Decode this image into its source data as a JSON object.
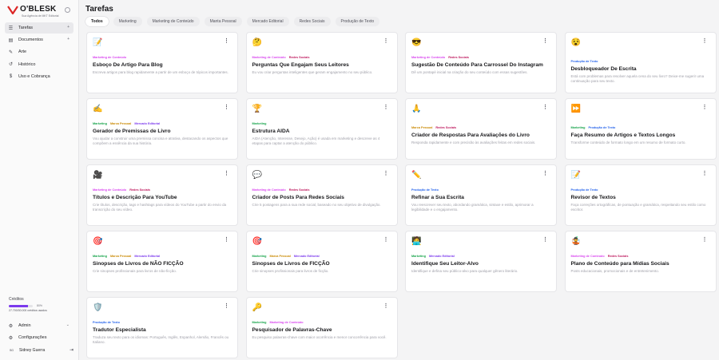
{
  "brand": {
    "name": "O'BLESK",
    "subtitle": "Sua Agência de MKT Editorial",
    "colors": {
      "accent": "#7c3aed",
      "mark": "#dc2626"
    }
  },
  "sidebar": {
    "items": [
      {
        "label": "Tarefas",
        "icon": "list-icon",
        "chevron": "+"
      },
      {
        "label": "Documentos",
        "icon": "document-icon",
        "chevron": "+"
      },
      {
        "label": "Arte",
        "icon": "brush-icon"
      },
      {
        "label": "Histórico",
        "icon": "history-icon"
      },
      {
        "label": "Uso e Cobrança",
        "icon": "billing-icon"
      }
    ],
    "credits": {
      "label": "Créditos",
      "percent_used": 80,
      "percent_text": "80%",
      "detail": "27.700/30.000 créditos usados"
    },
    "bottom": [
      {
        "label": "Admin",
        "icon": "admin-icon",
        "chevron": "⌄"
      },
      {
        "label": "Configurações",
        "icon": "gear-icon"
      }
    ],
    "user": {
      "initials": "SG",
      "name": "Sidney Guerra"
    }
  },
  "page": {
    "title": "Tarefas"
  },
  "tabs": [
    "Todos",
    "Marketing",
    "Marketing de Conteúdo",
    "Manta Pessoal",
    "Mercado Editorial",
    "Redes Sociais",
    "Produção de Texto"
  ],
  "tag_colors": {
    "Marketing de Conteúdo": "#d946ef",
    "Redes Sociais": "#be185d",
    "Produção de Texto": "#2563eb",
    "Marketing": "#16a34a",
    "Marca Pessoal": "#ca8a04",
    "Mercado Editorial": "#7c3aed"
  },
  "cards": [
    {
      "emoji": "📝",
      "tags": [
        "Marketing de Conteúdo"
      ],
      "title": "Esboço De Artigo Para Blog",
      "desc": "Escreva artigos para blog rapidamente a partir de um esboço de tópicos importantes."
    },
    {
      "emoji": "🤔",
      "tags": [
        "Marketing de Conteúdo",
        "Redes Sociais"
      ],
      "title": "Perguntas Que Engajam Seus Leitores",
      "desc": "Eu vou criar perguntas inteligentes que geram engajamento no seu público."
    },
    {
      "emoji": "😎",
      "tags": [
        "Marketing de Conteúdo",
        "Redes Sociais"
      ],
      "title": "Sugestão De Conteúdo Para Carrossel Do Instagram",
      "desc": "Dê um pontapé inicial na criação do seu conteúdo com essas sugestões."
    },
    {
      "emoji": "😵",
      "tags": [
        "Produção de Texto"
      ],
      "title": "Desbloqueador De Escrita",
      "desc": "Está com problemas para resolver aquela cena do seu livro? Deixe-me sugerir uma continuação para seu texto."
    },
    {
      "emoji": "✍️",
      "tags": [
        "Marketing",
        "Marca Pessoal",
        "Mercado Editorial"
      ],
      "title": "Gerador de Premissas de Livro",
      "desc": "Vou ajudar a construir uma premissa concisa e atrativa, destacando os aspectos que compõem a essência da sua história."
    },
    {
      "emoji": "🏆",
      "tags": [
        "Marketing"
      ],
      "title": "Estrutura AIDA",
      "desc": "AIDA (Atenção, Interesse, Desejo, Ação) é usada em marketing e descreve as 4 etapas para captar a atenção do público."
    },
    {
      "emoji": "🙏",
      "tags": [
        "Marca Pessoal",
        "Redes Sociais"
      ],
      "title": "Criador de Respostas Para Avaliações do Livro",
      "desc": "Responda rapidamente e com precisão às avaliações feitas em redes sociais."
    },
    {
      "emoji": "⏩",
      "tags": [
        "Marketing",
        "Produção de Texto"
      ],
      "title": "Faça Resumo de Artigos e Textos Longos",
      "desc": "Transforme conteúdo de formato longo em um resumo de formato curto."
    },
    {
      "emoji": "🎥",
      "tags": [
        "Marketing de Conteúdo",
        "Redes Sociais"
      ],
      "title": "Títulos e Descrição Para YouTube",
      "desc": "Crie títulos, descrição, tags e hashtags para vídeos do YouTube a partir do envio da transcrição do seu vídeo."
    },
    {
      "emoji": "💬",
      "tags": [
        "Marketing de Conteúdo",
        "Redes Sociais"
      ],
      "title": "Criador de Posts Para Redes Sociais",
      "desc": "Crie 5 postagens para a sua rede social, baseado no seu objetivo de divulgação."
    },
    {
      "emoji": "✏️",
      "tags": [
        "Produção de Texto"
      ],
      "title": "Refinar a Sua Escrita",
      "desc": "Vou reescrever seu texto, abordando gramática, sintaxe e estilo, aprimorar a legibilidade e o engajamento."
    },
    {
      "emoji": "📝",
      "tags": [
        "Produção de Texto"
      ],
      "title": "Revisor de Textos",
      "desc": "Faça correções ortográficas, de pontuação e gramática, respeitando seu estilo como escritor."
    },
    {
      "emoji": "🎯",
      "tags": [
        "Marketing",
        "Marca Pessoal",
        "Mercado Editorial"
      ],
      "title": "Sinopses de Livros de NÃO FICÇÃO",
      "desc": "Crie sinopses profissionais para livros de não-ficção."
    },
    {
      "emoji": "🎯",
      "tags": [
        "Marketing",
        "Marca Pessoal",
        "Mercado Editorial"
      ],
      "title": "Sinopses de Livros de FICÇÃO",
      "desc": "Crie sinopses profissionais para livros de ficção."
    },
    {
      "emoji": "🧑‍💻",
      "tags": [
        "Marketing",
        "Mercado Editorial"
      ],
      "title": "Identifique Seu Leitor-Alvo",
      "desc": "Identifique e defina seu público-alvo para qualquer gênero literário."
    },
    {
      "emoji": "🤹",
      "tags": [
        "Marketing de Conteúdo",
        "Redes Sociais"
      ],
      "title": "Plano de Conteúdo para Mídias Sociais",
      "desc": "Posts educacionais, promocionais e de entretenimento."
    },
    {
      "emoji": "🛡️",
      "tags": [
        "Produção de Texto"
      ],
      "title": "Tradutor Especialista",
      "desc": "Traduza seu texto para os idiomas: Português, Inglês, Espanhol, Alemão, Francês ou Italiano."
    },
    {
      "emoji": "🔑",
      "tags": [
        "Marketing",
        "Marketing de Conteúdo"
      ],
      "title": "Pesquisador de Palavras-Chave",
      "desc": "Eu pesquiso palavras-chave com maior ocorrência e menor concorrência para você."
    }
  ]
}
